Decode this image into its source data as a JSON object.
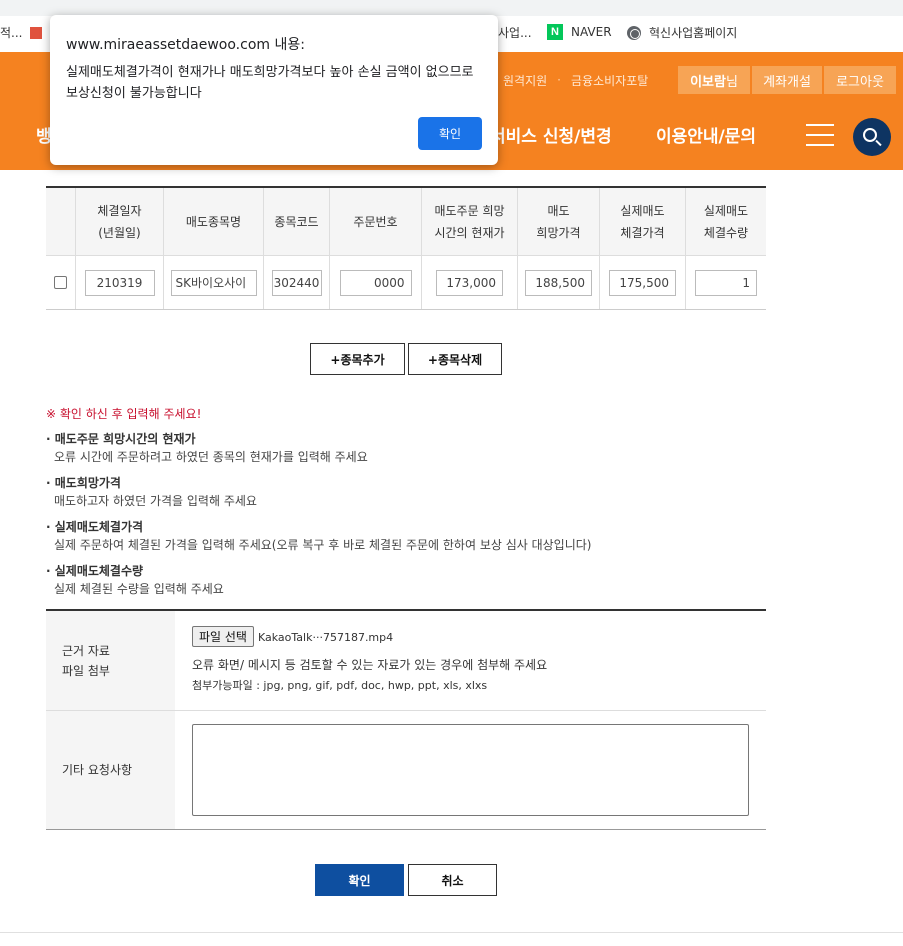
{
  "bookmarks": {
    "left_fragment": "적...",
    "mid_fragment": "사업...",
    "naver_label": "NAVER",
    "naver_icon_letter": "N",
    "innovation_label": "혁신사업홈페이지"
  },
  "header": {
    "util_links": [
      "원격지원",
      "금융소비자포탈"
    ],
    "user_name": "이보람",
    "user_suffix": "님",
    "open_account": "계좌개설",
    "logout": "로그아웃",
    "gnb_left_fragment": "뱅",
    "gnb_items": [
      "서비스 신청/변경",
      "이용안내/문의"
    ],
    "brand_color": "#f58220"
  },
  "dialog": {
    "title": "www.miraeassetdaewoo.com 내용:",
    "message": "실제매도체결가격이  현재가나 매도희망가격보다 높아 손실 금액이 없으므로 보상신청이 불가능합니다",
    "ok_label": "확인"
  },
  "table": {
    "headers": [
      "",
      "체결일자\n(년월일)",
      "매도종목명",
      "종목코드",
      "주문번호",
      "매도주문 희망\n시간의 현재가",
      "매도\n희망가격",
      "실제매도\n체결가격",
      "실제매도\n체결수량"
    ],
    "row": {
      "date": "210319",
      "stock_name": "SK바이오사이",
      "stock_code": "302440",
      "order_no": "0000",
      "current_price": "173,000",
      "wish_price": "188,500",
      "exec_price": "175,500",
      "exec_qty": "1"
    }
  },
  "buttons": {
    "add_item": "+종목추가",
    "delete_item": "+종목삭제",
    "confirm": "확인",
    "cancel": "취소"
  },
  "notes": {
    "warning": "※ 확인 하신 후 입력해 주세요!",
    "items": [
      {
        "title": "· 매도주문 희망시간의 현재가",
        "desc": "오류 시간에 주문하려고 하였던 종목의 현재가를 입력해 주세요"
      },
      {
        "title": "· 매도희망가격",
        "desc": "매도하고자 하였던 가격을 입력해 주세요"
      },
      {
        "title": "· 실제매도체결가격",
        "desc": "실제 주문하여 체결된 가격을 입력해 주세요(오류 복구 후 바로 체결된 주문에 한하여 보상 심사 대상입니다)"
      },
      {
        "title": "· 실제매도체결수량",
        "desc": "실제 체결된 수량을 입력해 주세요"
      }
    ]
  },
  "form": {
    "file_label_line1": "근거 자료",
    "file_label_line2": "파일 첨부",
    "file_button": "파일 선택",
    "file_name": "KakaoTalk···757187.mp4",
    "file_help": "오류 화면/ 메시지 등 검토할 수 있는 자료가 있는 경우에 첨부해 주세요",
    "file_types": "첨부가능파일 : jpg, png, gif, pdf, doc, hwp, ppt, xls, xlxs",
    "etc_label": "기타 요청사항"
  }
}
